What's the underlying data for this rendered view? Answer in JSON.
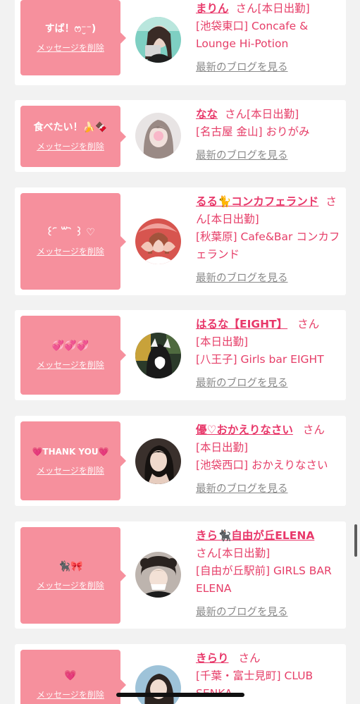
{
  "delete_label": "メッセージを削除",
  "blog_label": "最新のブログを見る",
  "san": "さん",
  "colors": {
    "bubble": "#f6909d",
    "accent": "#e63e68",
    "link_gray": "#8a8a8a",
    "background": "#f2f2f2"
  },
  "items": [
    {
      "message": "すば！ෆ⁻̮⁻)",
      "name": "まりん",
      "status": "[本日出勤]",
      "shop": "[池袋東口] Concafe & Lounge Hi-Potion",
      "avatar_icon": "girl-photo"
    },
    {
      "message": "食べたい！🍌🍫",
      "name": "なな",
      "status": "[本日出勤]",
      "shop": "[名古屋 金山] おりがみ",
      "avatar_icon": "girl-photo"
    },
    {
      "message": "꒰ ᷇ ꒳ ᷆ ꒱ ♡",
      "name": "るる🐈コンカフェランド",
      "status": "[本日出勤]",
      "shop": "[秋葉原] Cafe&Bar コンカフェランド",
      "avatar_icon": "girl-photo"
    },
    {
      "message": "💞💞💞",
      "name": "はるな【EIGHT】",
      "status": "[本日出勤]",
      "shop": "[八王子] Girls bar EIGHT",
      "avatar_icon": "girl-photo"
    },
    {
      "message": "💗THANK YOU💗",
      "name": "優♡おかえりなさい",
      "status": "[本日出勤]",
      "shop": "[池袋西口] おかえりなさい",
      "avatar_icon": "girl-photo"
    },
    {
      "message": "🐈‍⬛🎀",
      "name": "きら🐈‍⬛自由が丘ELENA",
      "status": "[本日出勤]",
      "shop": "[自由が丘駅前] GIRLS BAR ELENA",
      "avatar_icon": "girl-photo"
    },
    {
      "message": "💗",
      "name": "きらり",
      "status": "[千葉・富士見町] CLUB",
      "shop": "SENKA",
      "avatar_icon": "girl-photo"
    }
  ]
}
